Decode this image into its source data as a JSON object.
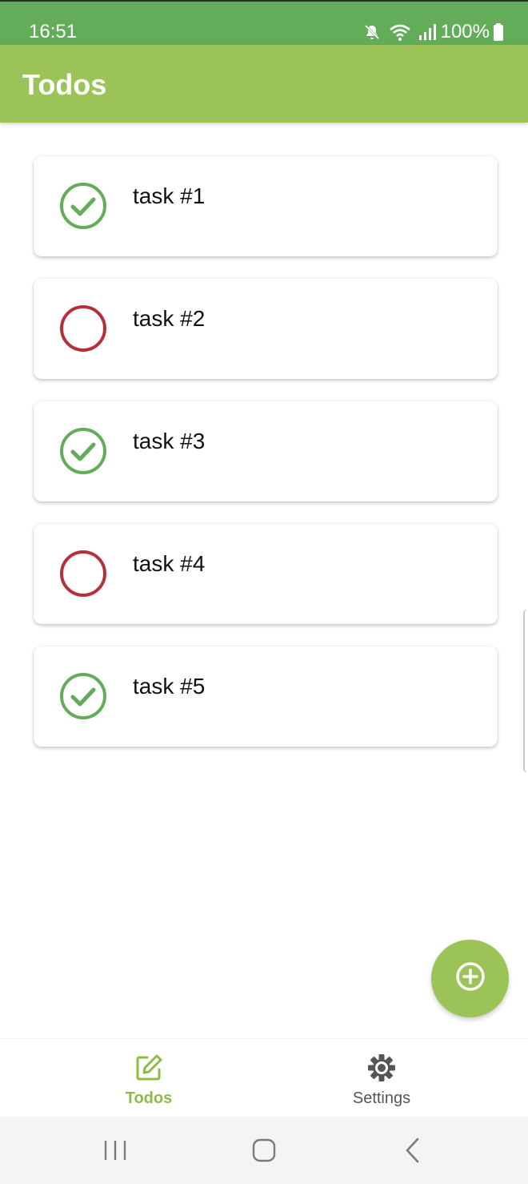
{
  "status_bar": {
    "time": "16:51",
    "battery": "100%",
    "icons": [
      "mute-icon",
      "wifi-icon",
      "signal-icon",
      "battery-icon"
    ]
  },
  "app_bar": {
    "title": "Todos",
    "color": "#9cc357"
  },
  "todos": [
    {
      "label": "task #1",
      "done": true
    },
    {
      "label": "task #2",
      "done": false
    },
    {
      "label": "task #3",
      "done": true
    },
    {
      "label": "task #4",
      "done": false
    },
    {
      "label": "task #5",
      "done": true
    }
  ],
  "colors": {
    "done": "#63ad5a",
    "not_done": "#b5303a",
    "accent": "#9cc357",
    "status_bar": "#63ad5a"
  },
  "fab": {
    "icon": "add-circle-icon"
  },
  "bottom_nav": {
    "items": [
      {
        "label": "Todos",
        "icon": "edit-icon",
        "active": true
      },
      {
        "label": "Settings",
        "icon": "gear-icon",
        "active": false
      }
    ]
  },
  "system_nav": {
    "icons": [
      "recents-icon",
      "home-icon",
      "back-icon"
    ]
  }
}
